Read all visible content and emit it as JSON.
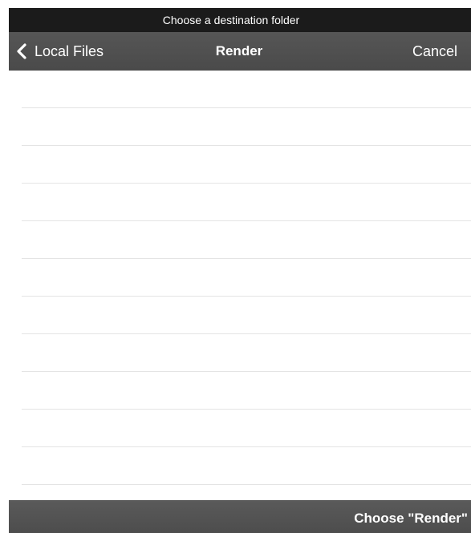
{
  "prompt": {
    "title": "Choose a destination folder"
  },
  "nav": {
    "back_label": "Local Files",
    "back_icon": "chevron-left-icon",
    "title": "Render",
    "cancel_label": "Cancel"
  },
  "folder_list": {
    "rows": [
      {},
      {},
      {},
      {},
      {},
      {},
      {},
      {},
      {},
      {},
      {}
    ]
  },
  "toolbar": {
    "choose_label": "Choose \"Render\""
  },
  "colors": {
    "prompt_bar": "#1b1b1b",
    "nav_bar": "#505050",
    "bottom_bar": "#535353",
    "separator": "#e4e4e4",
    "text_on_dark": "#ffffff"
  }
}
